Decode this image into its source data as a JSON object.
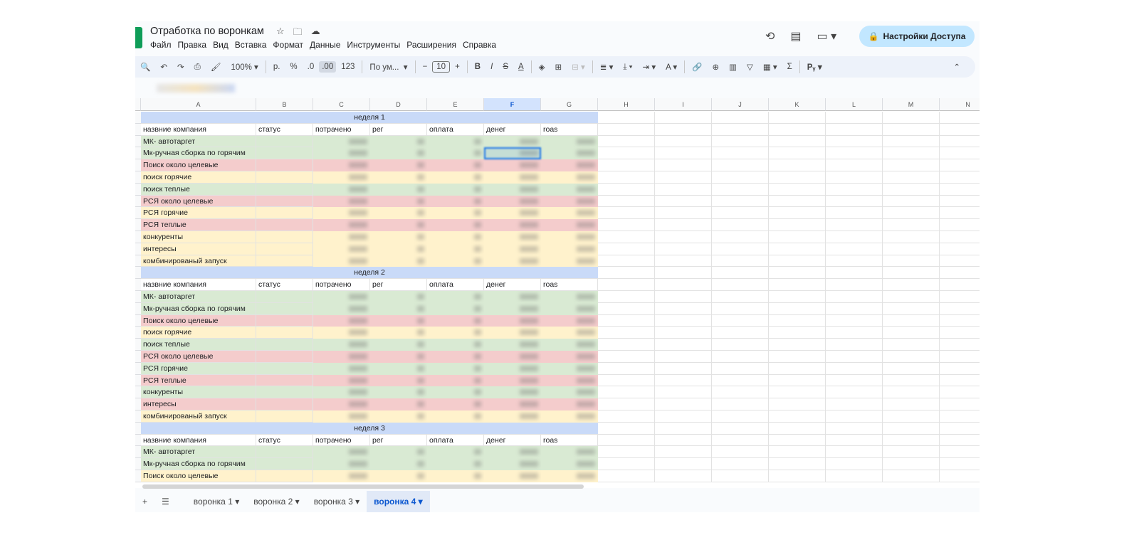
{
  "document": {
    "title": "Отработка по воронкам"
  },
  "menu": [
    "Файл",
    "Правка",
    "Вид",
    "Вставка",
    "Формат",
    "Данные",
    "Инструменты",
    "Расширения",
    "Справка"
  ],
  "share_button": {
    "label": "Настройки Доступа"
  },
  "toolbar": {
    "zoom": "100%",
    "currency": "р.",
    "percent": "%",
    "dec_decrease": ".0",
    "dec_increase": ".00",
    "number_format": "123",
    "font": "По ум...",
    "font_size": "10"
  },
  "columns": [
    "A",
    "B",
    "C",
    "D",
    "E",
    "F",
    "G",
    "H",
    "I",
    "J",
    "K",
    "L",
    "M",
    "N"
  ],
  "selected_column": "F",
  "colors": {
    "green": "#d9ead3",
    "red": "#f4cccc",
    "yellow": "#fff2cc",
    "header_blue": "#c9daf8"
  },
  "blocks": [
    {
      "week": "неделя 1",
      "headers": [
        "назвние компания",
        "статус",
        "потрачено",
        "рег",
        "оплата",
        "денег",
        "roas"
      ],
      "rows": [
        {
          "name": "МК- автотаргет",
          "color": "green"
        },
        {
          "name": "Мк-ручная сборка по горячим",
          "color": "green"
        },
        {
          "name": "Поиск около целевые",
          "color": "red"
        },
        {
          "name": "поиск горячие",
          "color": "yellow"
        },
        {
          "name": "поиск теплые",
          "color": "green"
        },
        {
          "name": "РСЯ около целевые",
          "color": "red"
        },
        {
          "name": "РСЯ горячие",
          "color": "yellow"
        },
        {
          "name": "РСЯ теплые",
          "color": "red"
        },
        {
          "name": "конкуренты",
          "color": "yellow"
        },
        {
          "name": "интересы",
          "color": "yellow"
        },
        {
          "name": "комбинированый запуск",
          "color": "yellow"
        }
      ]
    },
    {
      "week": "неделя 2",
      "headers": [
        "назвние компания",
        "статус",
        "потрачено",
        "рег",
        "оплата",
        "денег",
        "roas"
      ],
      "rows": [
        {
          "name": "МК- автотаргет",
          "color": "green"
        },
        {
          "name": "Мк-ручная сборка по горячим",
          "color": "green"
        },
        {
          "name": "Поиск около целевые",
          "color": "red"
        },
        {
          "name": "поиск горячие",
          "color": "yellow"
        },
        {
          "name": "поиск теплые",
          "color": "green"
        },
        {
          "name": "РСЯ около целевые",
          "color": "red"
        },
        {
          "name": "РСЯ горячие",
          "color": "green"
        },
        {
          "name": "РСЯ теплые",
          "color": "red"
        },
        {
          "name": "конкуренты",
          "color": "green"
        },
        {
          "name": "интересы",
          "color": "red"
        },
        {
          "name": "комбинированый запуск",
          "color": "yellow"
        }
      ]
    },
    {
      "week": "неделя 3",
      "headers": [
        "назвние компания",
        "статус",
        "потрачено",
        "рег",
        "оплата",
        "денег",
        "roas"
      ],
      "rows": [
        {
          "name": "МК- автотаргет",
          "color": "green"
        },
        {
          "name": "Мк-ручная сборка по горячим",
          "color": "green"
        },
        {
          "name": "Поиск около целевые",
          "color": "yellow"
        }
      ]
    }
  ],
  "sheet_tabs": [
    {
      "label": "воронка 1",
      "active": false
    },
    {
      "label": "воронка 2",
      "active": false
    },
    {
      "label": "воронка 3",
      "active": false
    },
    {
      "label": "воронка 4",
      "active": true
    }
  ]
}
